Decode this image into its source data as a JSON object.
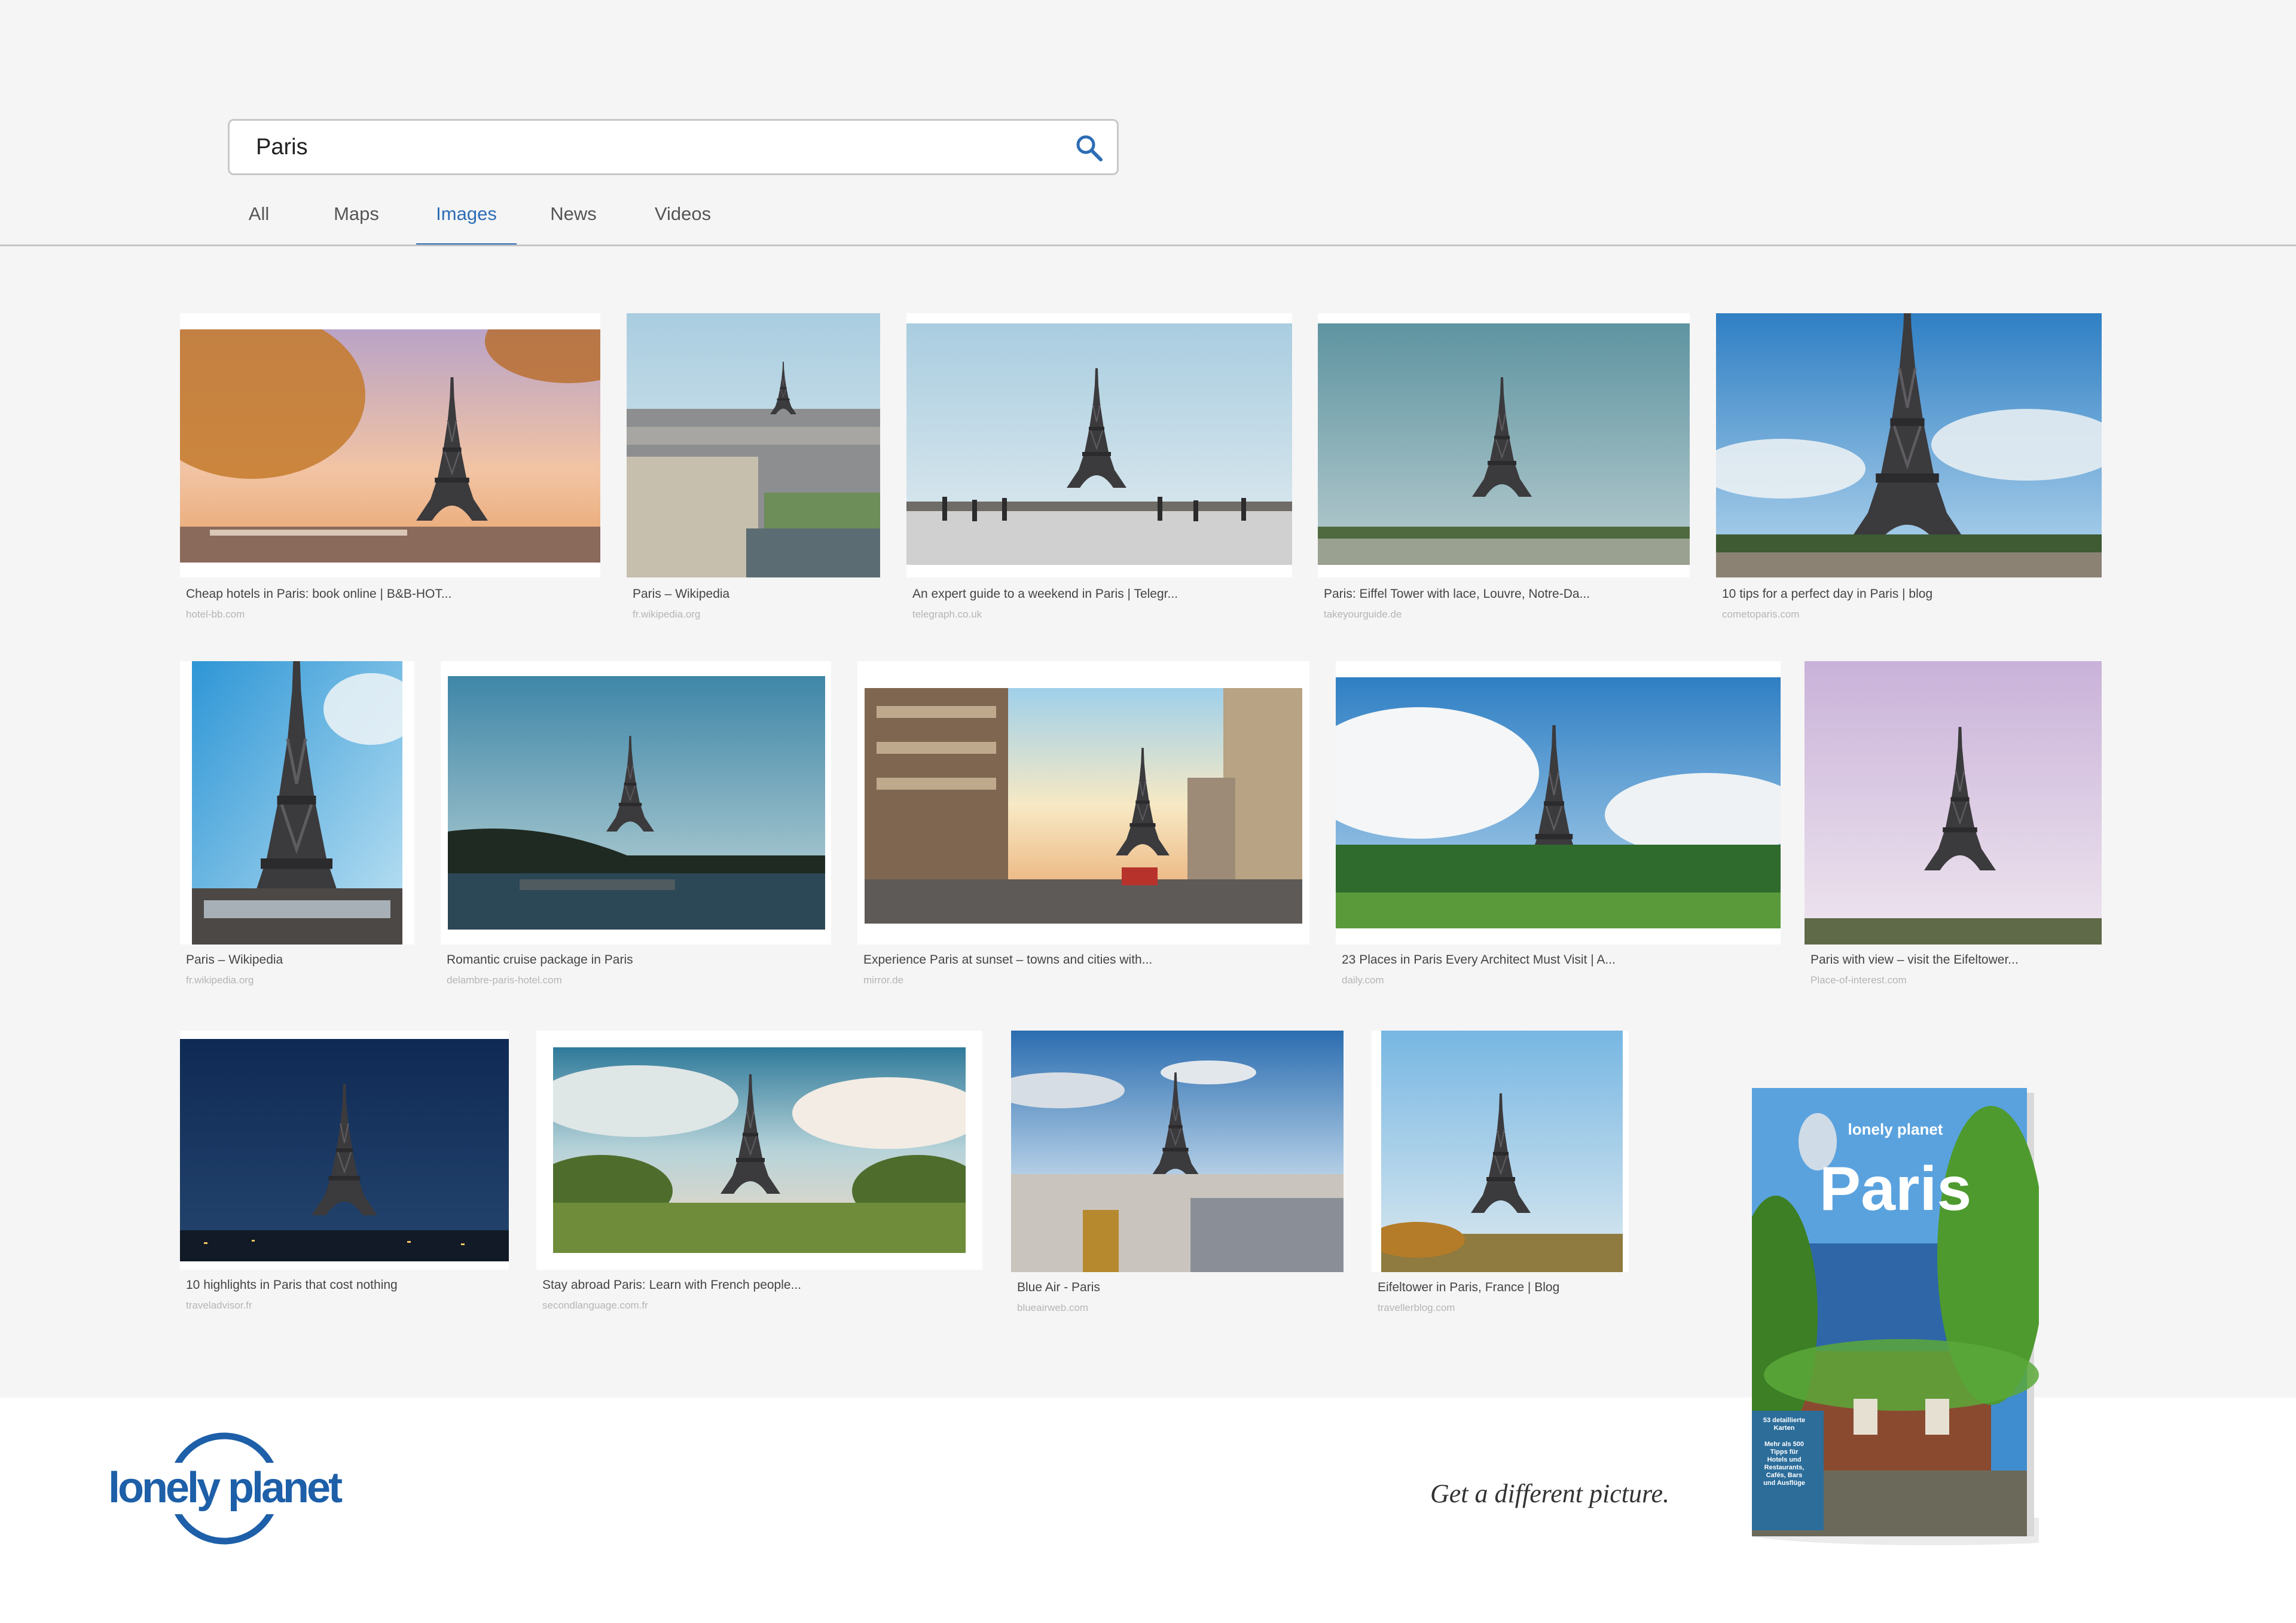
{
  "search": {
    "query": "Paris",
    "placeholder": ""
  },
  "tabs": [
    {
      "label": "All",
      "active": false
    },
    {
      "label": "Maps",
      "active": false
    },
    {
      "label": "Images",
      "active": true
    },
    {
      "label": "News",
      "active": false
    },
    {
      "label": "Videos",
      "active": false
    }
  ],
  "results": [
    {
      "title": "Cheap hotels in Paris: book online | B&B-HOT...",
      "source": "hotel-bb.com"
    },
    {
      "title": "Paris – Wikipedia",
      "source": "fr.wikipedia.org"
    },
    {
      "title": "An expert guide to a weekend in Paris | Telegr...",
      "source": "telegraph.co.uk"
    },
    {
      "title": "Paris: Eiffel Tower with lace, Louvre, Notre-Da...",
      "source": "takeyourguide.de"
    },
    {
      "title": "10 tips for a perfect day in Paris | blog",
      "source": "cometoparis.com"
    },
    {
      "title": "Paris – Wikipedia",
      "source": "fr.wikipedia.org"
    },
    {
      "title": "Romantic cruise package in Paris",
      "source": "delambre-paris-hotel.com"
    },
    {
      "title": "Experience Paris at sunset – towns and cities with...",
      "source": "mirror.de"
    },
    {
      "title": "23 Places in Paris Every Architect Must Visit | A...",
      "source": "daily.com"
    },
    {
      "title": "Paris with view – visit the Eifeltower...",
      "source": "Place-of-interest.com"
    },
    {
      "title": "10 highlights in Paris that cost nothing",
      "source": "traveladvisor.fr"
    },
    {
      "title": "Stay abroad Paris: Learn with French people...",
      "source": "secondlanguage.com.fr"
    },
    {
      "title": "Blue Air - Paris",
      "source": "blueairweb.com"
    },
    {
      "title": "Eifeltower in Paris, France | Blog",
      "source": "travellerblog.com"
    }
  ],
  "footer": {
    "logo_text": "lonely planet",
    "tagline": "Get a different picture."
  },
  "book": {
    "brand": "lonely planet",
    "title": "Paris",
    "note_maps": "53 detaillierte Karten",
    "note_tips": "Mehr als 500 Tipps für Hotels und Restaurants, Cafés, Bars und Ausflüge"
  },
  "colors": {
    "accent": "#2d6db5",
    "background": "#f5f5f5",
    "brand_blue": "#1d5fa8"
  },
  "icons": {
    "search": "search-icon",
    "logo": "lonely-planet-logo"
  }
}
